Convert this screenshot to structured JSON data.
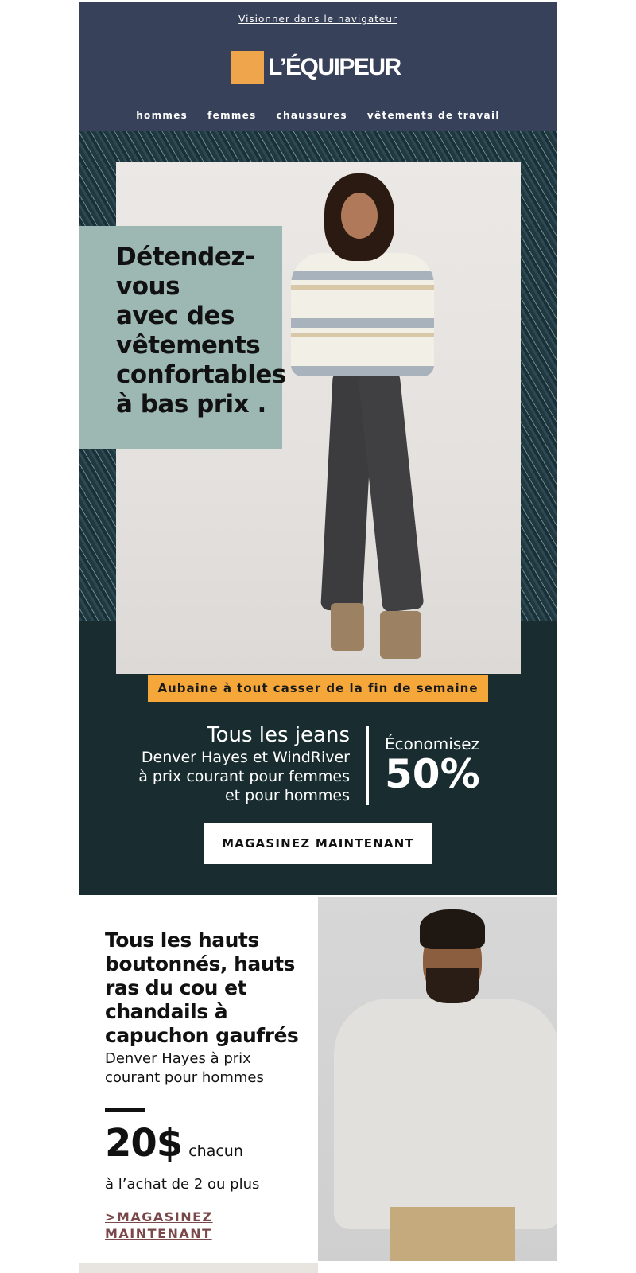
{
  "header": {
    "browser_link": "Visionner dans le navigateur",
    "logo_text": "L’ÉQUIPEUR",
    "nav": [
      "hommes",
      "femmes",
      "chaussures",
      "vêtements de travail"
    ]
  },
  "hero": {
    "caption_lines": [
      "Détendez-",
      "vous",
      "avec des",
      "vêtements",
      "confortables",
      "à bas prix ."
    ],
    "deal_banner": "Aubaine à tout casser de la fin de semaine",
    "offer_title": "Tous les jeans",
    "offer_sub_lines": [
      "Denver Hayes et WindRiver",
      "à prix courant pour femmes",
      "et pour hommes"
    ],
    "save_label": "Économisez",
    "save_pct": "50%",
    "cta": "MAGASINEZ MAINTENANT"
  },
  "block2": {
    "title_lines": [
      "Tous les hauts",
      "boutonnés, hauts",
      "ras du cou et",
      "chandails à",
      "capuchon gaufrés"
    ],
    "sub_lines": [
      "Denver Hayes à prix",
      "courant pour hommes"
    ],
    "price": "20$",
    "each": "chacun",
    "condition": "à l’achat de 2 ou plus",
    "link_lines": [
      ">MAGASINEZ",
      "MAINTENANT"
    ]
  },
  "colors": {
    "header_bg": "#38415a",
    "logo_accent": "#eea54b",
    "hero_dark": "#192d30",
    "caption_box": "#9db7b3",
    "banner": "#f5a73a",
    "link": "#7a4848"
  }
}
